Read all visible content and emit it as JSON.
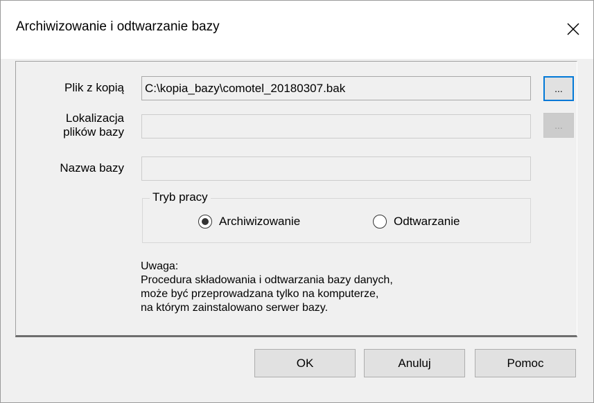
{
  "window": {
    "title": "Archiwizowanie i odtwarzanie bazy",
    "close_glyph": "✕"
  },
  "form": {
    "backup_file": {
      "label": "Plik z kopią",
      "value": "C:\\kopia_bazy\\comotel_20180307.bak",
      "browse_label": "..."
    },
    "db_location": {
      "label_line1": "Lokalizacja",
      "label_line2": "plików bazy",
      "value": "",
      "browse_label": "..."
    },
    "db_name": {
      "label": "Nazwa bazy",
      "value": ""
    }
  },
  "mode": {
    "legend": "Tryb pracy",
    "options": [
      {
        "label": "Archiwizowanie",
        "selected": true
      },
      {
        "label": "Odtwarzanie",
        "selected": false
      }
    ]
  },
  "note": {
    "lines": [
      "Uwaga:",
      "Procedura składowania i odtwarzania bazy danych,",
      "może być przeprowadzana tylko na komputerze,",
      "na którym zainstalowano serwer bazy."
    ]
  },
  "buttons": {
    "ok": "OK",
    "cancel": "Anuluj",
    "help": "Pomoc"
  },
  "colors": {
    "accent": "#0078d7",
    "background": "#f0f0f0"
  }
}
